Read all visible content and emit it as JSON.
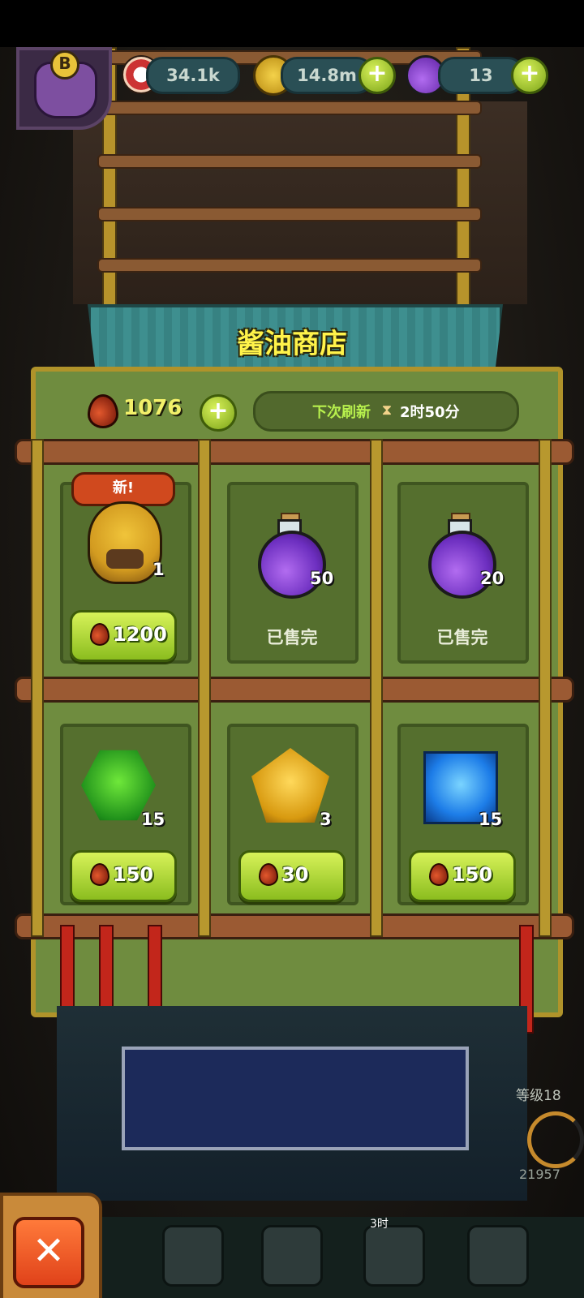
{
  "hud": {
    "eyes_value": "34.1k",
    "coins_value": "14.8m",
    "potions_value": "13",
    "plus_symbol": "+"
  },
  "avatar": {
    "badge": "B"
  },
  "shop": {
    "title": "酱油商店",
    "currency_value": "1076",
    "plus_symbol": "+",
    "refresh_label": "下次刷新",
    "refresh_time": "2时50分",
    "hourglass_icon": "⧗",
    "items": [
      {
        "name": "monster",
        "tag": "新!",
        "count": "1",
        "price": "1200",
        "sold_out": false
      },
      {
        "name": "purple-potion",
        "count": "50",
        "status": "已售完",
        "sold_out": true
      },
      {
        "name": "purple-potion",
        "count": "20",
        "status": "已售完",
        "sold_out": true
      },
      {
        "name": "green-gem",
        "count": "15",
        "price": "150",
        "sold_out": false
      },
      {
        "name": "amber-gem",
        "count": "3",
        "price": "30",
        "sold_out": false
      },
      {
        "name": "blue-gem",
        "count": "15",
        "price": "150",
        "sold_out": false
      }
    ]
  },
  "sidebar": {
    "level_label": "等级18",
    "score_value": "21957"
  },
  "nav": {
    "close_symbol": "✕",
    "timer_text": "3时"
  },
  "colors": {
    "title_yellow": "#fff34a",
    "price_green": "#8bbd1f",
    "refresh_green": "#b7f04d"
  }
}
